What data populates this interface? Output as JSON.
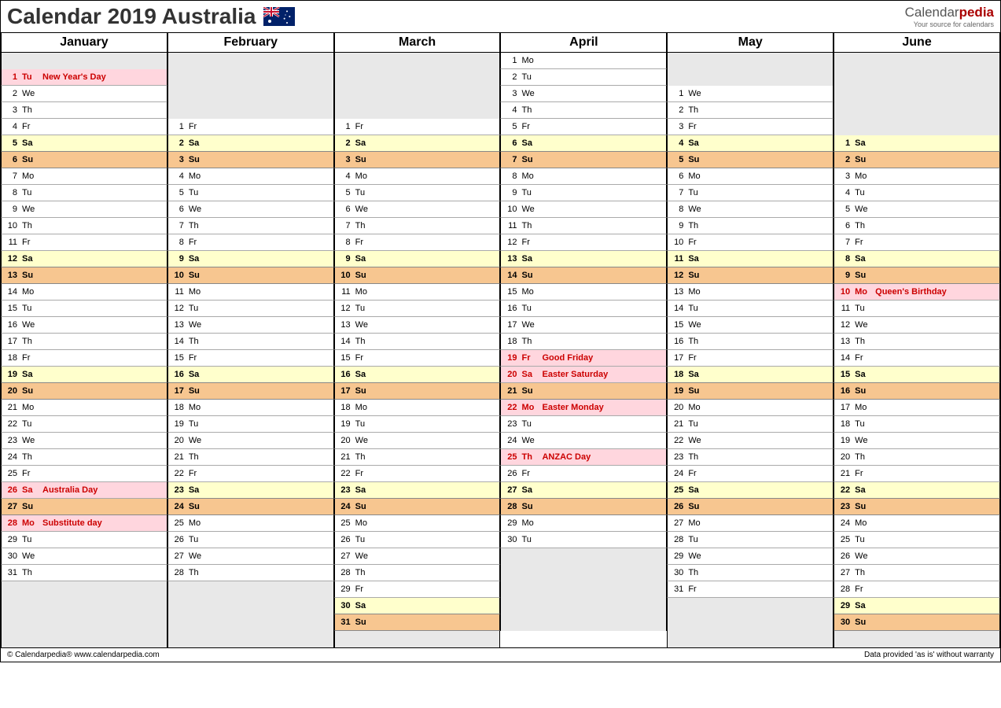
{
  "title": "Calendar 2019 Australia",
  "logo": {
    "main_prefix": "Calendar",
    "main_suffix": "pedia",
    "sub": "Your source for calendars"
  },
  "months": [
    "January",
    "February",
    "March",
    "April",
    "May",
    "June"
  ],
  "footer": {
    "left": "© Calendarpedia®   www.calendarpedia.com",
    "right": "Data provided 'as is' without warranty"
  },
  "calendar": [
    {
      "month": "January",
      "days": [
        null,
        {
          "n": 1,
          "d": "Tu",
          "e": "New Year's Day",
          "t": "holiday"
        },
        {
          "n": 2,
          "d": "We"
        },
        {
          "n": 3,
          "d": "Th"
        },
        {
          "n": 4,
          "d": "Fr"
        },
        {
          "n": 5,
          "d": "Sa",
          "t": "sat"
        },
        {
          "n": 6,
          "d": "Su",
          "t": "sun"
        },
        {
          "n": 7,
          "d": "Mo"
        },
        {
          "n": 8,
          "d": "Tu"
        },
        {
          "n": 9,
          "d": "We"
        },
        {
          "n": 10,
          "d": "Th"
        },
        {
          "n": 11,
          "d": "Fr"
        },
        {
          "n": 12,
          "d": "Sa",
          "t": "sat"
        },
        {
          "n": 13,
          "d": "Su",
          "t": "sun"
        },
        {
          "n": 14,
          "d": "Mo"
        },
        {
          "n": 15,
          "d": "Tu"
        },
        {
          "n": 16,
          "d": "We"
        },
        {
          "n": 17,
          "d": "Th"
        },
        {
          "n": 18,
          "d": "Fr"
        },
        {
          "n": 19,
          "d": "Sa",
          "t": "sat"
        },
        {
          "n": 20,
          "d": "Su",
          "t": "sun"
        },
        {
          "n": 21,
          "d": "Mo"
        },
        {
          "n": 22,
          "d": "Tu"
        },
        {
          "n": 23,
          "d": "We"
        },
        {
          "n": 24,
          "d": "Th"
        },
        {
          "n": 25,
          "d": "Fr"
        },
        {
          "n": 26,
          "d": "Sa",
          "e": "Australia Day",
          "t": "holiday"
        },
        {
          "n": 27,
          "d": "Su",
          "t": "sun"
        },
        {
          "n": 28,
          "d": "Mo",
          "e": "Substitute day",
          "t": "holiday"
        },
        {
          "n": 29,
          "d": "Tu"
        },
        {
          "n": 30,
          "d": "We"
        },
        {
          "n": 31,
          "d": "Th"
        },
        null,
        null,
        null,
        null
      ]
    },
    {
      "month": "February",
      "days": [
        null,
        null,
        null,
        null,
        {
          "n": 1,
          "d": "Fr"
        },
        {
          "n": 2,
          "d": "Sa",
          "t": "sat"
        },
        {
          "n": 3,
          "d": "Su",
          "t": "sun"
        },
        {
          "n": 4,
          "d": "Mo"
        },
        {
          "n": 5,
          "d": "Tu"
        },
        {
          "n": 6,
          "d": "We"
        },
        {
          "n": 7,
          "d": "Th"
        },
        {
          "n": 8,
          "d": "Fr"
        },
        {
          "n": 9,
          "d": "Sa",
          "t": "sat"
        },
        {
          "n": 10,
          "d": "Su",
          "t": "sun"
        },
        {
          "n": 11,
          "d": "Mo"
        },
        {
          "n": 12,
          "d": "Tu"
        },
        {
          "n": 13,
          "d": "We"
        },
        {
          "n": 14,
          "d": "Th"
        },
        {
          "n": 15,
          "d": "Fr"
        },
        {
          "n": 16,
          "d": "Sa",
          "t": "sat"
        },
        {
          "n": 17,
          "d": "Su",
          "t": "sun"
        },
        {
          "n": 18,
          "d": "Mo"
        },
        {
          "n": 19,
          "d": "Tu"
        },
        {
          "n": 20,
          "d": "We"
        },
        {
          "n": 21,
          "d": "Th"
        },
        {
          "n": 22,
          "d": "Fr"
        },
        {
          "n": 23,
          "d": "Sa",
          "t": "sat"
        },
        {
          "n": 24,
          "d": "Su",
          "t": "sun"
        },
        {
          "n": 25,
          "d": "Mo"
        },
        {
          "n": 26,
          "d": "Tu"
        },
        {
          "n": 27,
          "d": "We"
        },
        {
          "n": 28,
          "d": "Th"
        },
        null,
        null,
        null,
        null
      ]
    },
    {
      "month": "March",
      "days": [
        null,
        null,
        null,
        null,
        {
          "n": 1,
          "d": "Fr"
        },
        {
          "n": 2,
          "d": "Sa",
          "t": "sat"
        },
        {
          "n": 3,
          "d": "Su",
          "t": "sun"
        },
        {
          "n": 4,
          "d": "Mo"
        },
        {
          "n": 5,
          "d": "Tu"
        },
        {
          "n": 6,
          "d": "We"
        },
        {
          "n": 7,
          "d": "Th"
        },
        {
          "n": 8,
          "d": "Fr"
        },
        {
          "n": 9,
          "d": "Sa",
          "t": "sat"
        },
        {
          "n": 10,
          "d": "Su",
          "t": "sun"
        },
        {
          "n": 11,
          "d": "Mo"
        },
        {
          "n": 12,
          "d": "Tu"
        },
        {
          "n": 13,
          "d": "We"
        },
        {
          "n": 14,
          "d": "Th"
        },
        {
          "n": 15,
          "d": "Fr"
        },
        {
          "n": 16,
          "d": "Sa",
          "t": "sat"
        },
        {
          "n": 17,
          "d": "Su",
          "t": "sun"
        },
        {
          "n": 18,
          "d": "Mo"
        },
        {
          "n": 19,
          "d": "Tu"
        },
        {
          "n": 20,
          "d": "We"
        },
        {
          "n": 21,
          "d": "Th"
        },
        {
          "n": 22,
          "d": "Fr"
        },
        {
          "n": 23,
          "d": "Sa",
          "t": "sat"
        },
        {
          "n": 24,
          "d": "Su",
          "t": "sun"
        },
        {
          "n": 25,
          "d": "Mo"
        },
        {
          "n": 26,
          "d": "Tu"
        },
        {
          "n": 27,
          "d": "We"
        },
        {
          "n": 28,
          "d": "Th"
        },
        {
          "n": 29,
          "d": "Fr"
        },
        {
          "n": 30,
          "d": "Sa",
          "t": "sat"
        },
        {
          "n": 31,
          "d": "Su",
          "t": "sun"
        },
        null
      ]
    },
    {
      "month": "April",
      "days": [
        {
          "n": 1,
          "d": "Mo"
        },
        {
          "n": 2,
          "d": "Tu"
        },
        {
          "n": 3,
          "d": "We"
        },
        {
          "n": 4,
          "d": "Th"
        },
        {
          "n": 5,
          "d": "Fr"
        },
        {
          "n": 6,
          "d": "Sa",
          "t": "sat"
        },
        {
          "n": 7,
          "d": "Su",
          "t": "sun"
        },
        {
          "n": 8,
          "d": "Mo"
        },
        {
          "n": 9,
          "d": "Tu"
        },
        {
          "n": 10,
          "d": "We"
        },
        {
          "n": 11,
          "d": "Th"
        },
        {
          "n": 12,
          "d": "Fr"
        },
        {
          "n": 13,
          "d": "Sa",
          "t": "sat"
        },
        {
          "n": 14,
          "d": "Su",
          "t": "sun"
        },
        {
          "n": 15,
          "d": "Mo"
        },
        {
          "n": 16,
          "d": "Tu"
        },
        {
          "n": 17,
          "d": "We"
        },
        {
          "n": 18,
          "d": "Th"
        },
        {
          "n": 19,
          "d": "Fr",
          "e": "Good Friday",
          "t": "holiday"
        },
        {
          "n": 20,
          "d": "Sa",
          "e": "Easter Saturday",
          "t": "holiday"
        },
        {
          "n": 21,
          "d": "Su",
          "t": "sun"
        },
        {
          "n": 22,
          "d": "Mo",
          "e": "Easter Monday",
          "t": "holiday"
        },
        {
          "n": 23,
          "d": "Tu"
        },
        {
          "n": 24,
          "d": "We"
        },
        {
          "n": 25,
          "d": "Th",
          "e": "ANZAC Day",
          "t": "holiday"
        },
        {
          "n": 26,
          "d": "Fr"
        },
        {
          "n": 27,
          "d": "Sa",
          "t": "sat"
        },
        {
          "n": 28,
          "d": "Su",
          "t": "sun"
        },
        {
          "n": 29,
          "d": "Mo"
        },
        {
          "n": 30,
          "d": "Tu"
        },
        null,
        null,
        null,
        null,
        null
      ]
    },
    {
      "month": "May",
      "days": [
        null,
        null,
        {
          "n": 1,
          "d": "We"
        },
        {
          "n": 2,
          "d": "Th"
        },
        {
          "n": 3,
          "d": "Fr"
        },
        {
          "n": 4,
          "d": "Sa",
          "t": "sat"
        },
        {
          "n": 5,
          "d": "Su",
          "t": "sun"
        },
        {
          "n": 6,
          "d": "Mo"
        },
        {
          "n": 7,
          "d": "Tu"
        },
        {
          "n": 8,
          "d": "We"
        },
        {
          "n": 9,
          "d": "Th"
        },
        {
          "n": 10,
          "d": "Fr"
        },
        {
          "n": 11,
          "d": "Sa",
          "t": "sat"
        },
        {
          "n": 12,
          "d": "Su",
          "t": "sun"
        },
        {
          "n": 13,
          "d": "Mo"
        },
        {
          "n": 14,
          "d": "Tu"
        },
        {
          "n": 15,
          "d": "We"
        },
        {
          "n": 16,
          "d": "Th"
        },
        {
          "n": 17,
          "d": "Fr"
        },
        {
          "n": 18,
          "d": "Sa",
          "t": "sat"
        },
        {
          "n": 19,
          "d": "Su",
          "t": "sun"
        },
        {
          "n": 20,
          "d": "Mo"
        },
        {
          "n": 21,
          "d": "Tu"
        },
        {
          "n": 22,
          "d": "We"
        },
        {
          "n": 23,
          "d": "Th"
        },
        {
          "n": 24,
          "d": "Fr"
        },
        {
          "n": 25,
          "d": "Sa",
          "t": "sat"
        },
        {
          "n": 26,
          "d": "Su",
          "t": "sun"
        },
        {
          "n": 27,
          "d": "Mo"
        },
        {
          "n": 28,
          "d": "Tu"
        },
        {
          "n": 29,
          "d": "We"
        },
        {
          "n": 30,
          "d": "Th"
        },
        {
          "n": 31,
          "d": "Fr"
        },
        null,
        null,
        null
      ]
    },
    {
      "month": "June",
      "days": [
        null,
        null,
        null,
        null,
        null,
        {
          "n": 1,
          "d": "Sa",
          "t": "sat"
        },
        {
          "n": 2,
          "d": "Su",
          "t": "sun"
        },
        {
          "n": 3,
          "d": "Mo"
        },
        {
          "n": 4,
          "d": "Tu"
        },
        {
          "n": 5,
          "d": "We"
        },
        {
          "n": 6,
          "d": "Th"
        },
        {
          "n": 7,
          "d": "Fr"
        },
        {
          "n": 8,
          "d": "Sa",
          "t": "sat"
        },
        {
          "n": 9,
          "d": "Su",
          "t": "sun"
        },
        {
          "n": 10,
          "d": "Mo",
          "e": "Queen's Birthday",
          "t": "holiday"
        },
        {
          "n": 11,
          "d": "Tu"
        },
        {
          "n": 12,
          "d": "We"
        },
        {
          "n": 13,
          "d": "Th"
        },
        {
          "n": 14,
          "d": "Fr"
        },
        {
          "n": 15,
          "d": "Sa",
          "t": "sat"
        },
        {
          "n": 16,
          "d": "Su",
          "t": "sun"
        },
        {
          "n": 17,
          "d": "Mo"
        },
        {
          "n": 18,
          "d": "Tu"
        },
        {
          "n": 19,
          "d": "We"
        },
        {
          "n": 20,
          "d": "Th"
        },
        {
          "n": 21,
          "d": "Fr"
        },
        {
          "n": 22,
          "d": "Sa",
          "t": "sat"
        },
        {
          "n": 23,
          "d": "Su",
          "t": "sun"
        },
        {
          "n": 24,
          "d": "Mo"
        },
        {
          "n": 25,
          "d": "Tu"
        },
        {
          "n": 26,
          "d": "We"
        },
        {
          "n": 27,
          "d": "Th"
        },
        {
          "n": 28,
          "d": "Fr"
        },
        {
          "n": 29,
          "d": "Sa",
          "t": "sat"
        },
        {
          "n": 30,
          "d": "Su",
          "t": "sun"
        },
        null
      ]
    }
  ]
}
